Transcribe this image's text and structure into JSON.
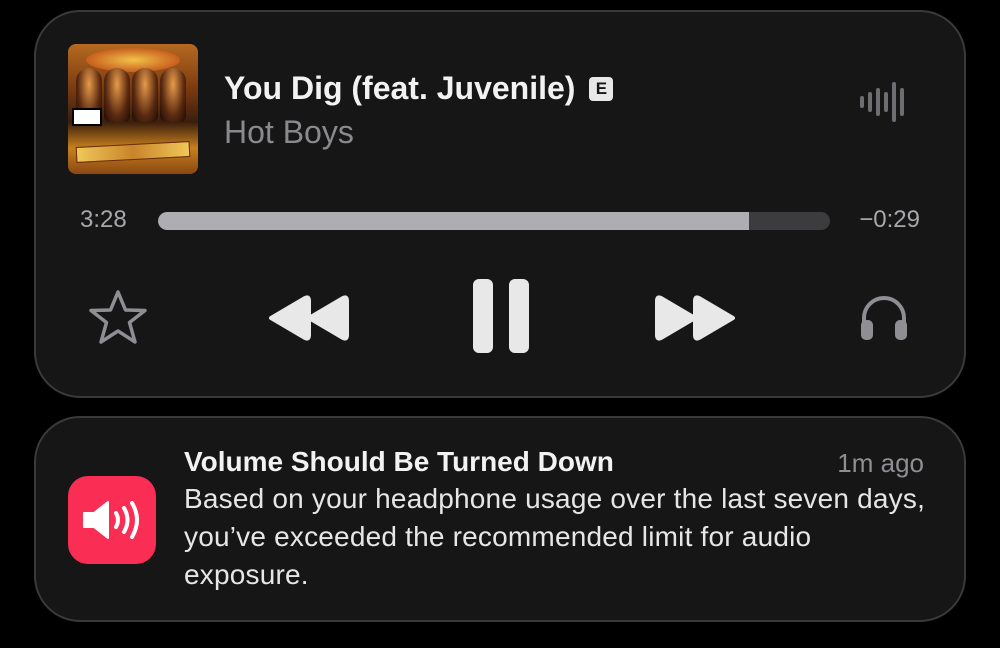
{
  "player": {
    "song_title": "You Dig (feat. Juvenile)",
    "explicit_badge": "E",
    "artist": "Hot Boys",
    "elapsed": "3:28",
    "remaining": "−0:29",
    "progress_fraction": 0.88,
    "icons": {
      "album_art": "album-art",
      "waveform": "waveform-icon",
      "favorite": "star-icon",
      "rewind": "rewind-icon",
      "pause": "pause-icon",
      "fast_forward": "fast-forward-icon",
      "audio_output": "headphones-icon"
    }
  },
  "notification": {
    "title": "Volume Should Be Turned Down",
    "time": "1m ago",
    "body": "Based on your headphone usage over the last seven days, you’ve exceeded the recommended limit for audio exposure.",
    "app_icon": "speaker-volume-icon",
    "app_icon_color": "#fa2d55"
  },
  "colors": {
    "background": "#000000",
    "card": "#161616",
    "progress_track": "#3c3c3f",
    "progress_fill": "#aeaeb2",
    "secondary_text": "#8a8a8e"
  }
}
